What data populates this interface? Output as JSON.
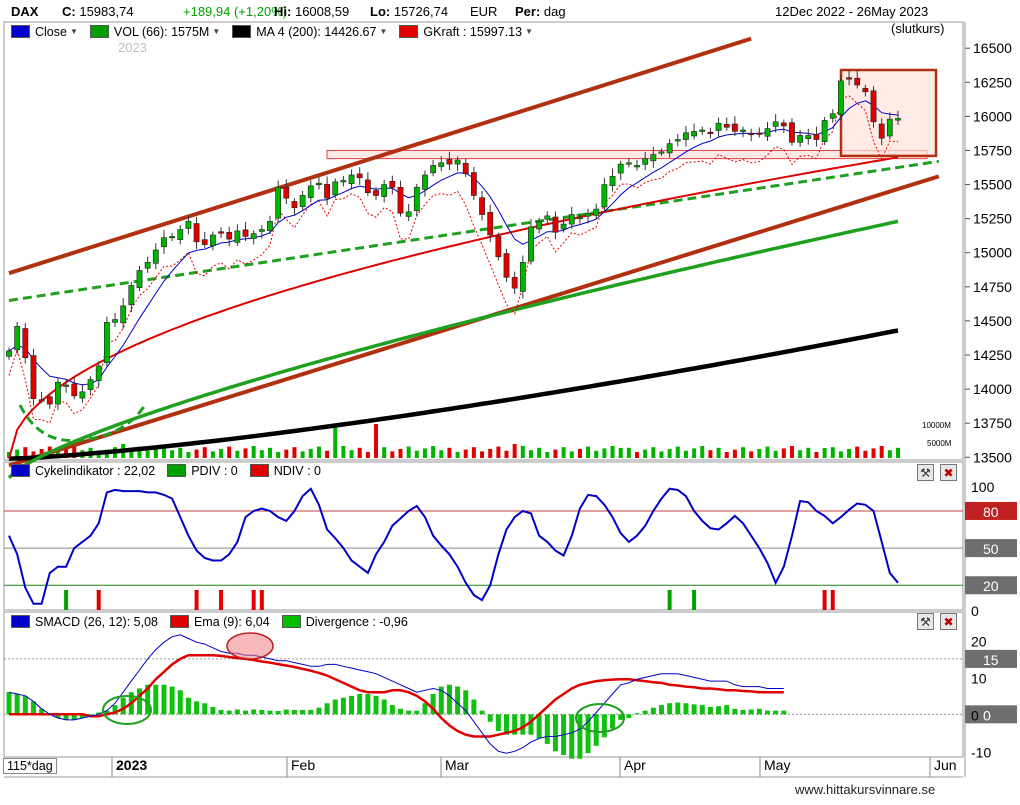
{
  "header": {
    "symbol": "DAX",
    "close_label": "C:",
    "close_value": "15983,74",
    "change": "+189,94 (+1,20%)",
    "hi_label": "Hi:",
    "hi_value": "16008,59",
    "lo_label": "Lo:",
    "lo_value": "15726,74",
    "currency": "EUR",
    "period_label": "Per:",
    "period_value": "dag",
    "date_range": "12Dec 2022 - 26May 2023",
    "price_basis": "(slutkurs)"
  },
  "legend_main": [
    {
      "label": "Close",
      "color": "#0000c8"
    },
    {
      "label": "VOL (66): 1575M",
      "color": "#00a000"
    },
    {
      "label": "MA 4 (200): 14426.67",
      "color": "#000000"
    },
    {
      "label": "GKraft : 15997.13",
      "color": "#e00000"
    }
  ],
  "legend_cycle": [
    {
      "label": "Cykelindikator : 22,02",
      "color": "#0000c8"
    },
    {
      "label": "PDIV : 0",
      "color": "#00a000"
    },
    {
      "label": "NDIV : 0",
      "color": "#e00000"
    }
  ],
  "legend_macd": [
    {
      "label": "SMACD (26, 12): 5,08",
      "color": "#0000c8"
    },
    {
      "label": "Ema (9): 6,04",
      "color": "#e00000"
    },
    {
      "label": "Divergence : -0,96",
      "color": "#00c000"
    }
  ],
  "watermark_year": "2023",
  "period_box": "115*dag",
  "footer_url": "www.hittakursvinnare.se",
  "icons": {
    "settings": "wrench-icon",
    "close": "close-icon"
  },
  "colors": {
    "up": "#00b400",
    "down": "#e00000",
    "close": "#0000c8",
    "trend": "#b03010",
    "ma200": "#000000",
    "ma_mid": "#20a020",
    "gkraft": "#e00000"
  },
  "chart_data": [
    {
      "type": "candlestick",
      "title": "DAX",
      "x_ticks": [
        "2023",
        "Feb",
        "Mar",
        "Apr",
        "May",
        "Jun"
      ],
      "y_ticks": [
        13500,
        13750,
        14000,
        14250,
        14500,
        14750,
        15000,
        15250,
        15500,
        15750,
        16000,
        16250,
        16500
      ],
      "ylim": [
        13480,
        16560
      ],
      "grid": false,
      "close_series": [
        14280,
        14460,
        14230,
        13930,
        13920,
        13890,
        14050,
        14030,
        13950,
        13980,
        14070,
        14170,
        14490,
        14510,
        14610,
        14760,
        14870,
        14930,
        15020,
        15110,
        15120,
        15170,
        15230,
        15080,
        15060,
        15130,
        15150,
        15100,
        15160,
        15120,
        15140,
        15170,
        15230,
        15480,
        15400,
        15330,
        15420,
        15490,
        15510,
        15400,
        15520,
        15530,
        15570,
        15550,
        15440,
        15420,
        15500,
        15480,
        15290,
        15300,
        15480,
        15570,
        15640,
        15660,
        15650,
        15680,
        15580,
        15420,
        15280,
        15130,
        14970,
        14820,
        14740,
        14930,
        15190,
        15230,
        15270,
        15150,
        15210,
        15280,
        15260,
        15290,
        15320,
        15500,
        15560,
        15650,
        15660,
        15640,
        15690,
        15720,
        15740,
        15800,
        15830,
        15880,
        15890,
        15900,
        15880,
        15950,
        15920,
        15890,
        15900,
        15870,
        15870,
        15910,
        15960,
        15930,
        15810,
        15860,
        15860,
        15830,
        15970,
        16020,
        16260,
        16280,
        16230,
        16180,
        15960,
        15840,
        15980,
        15984
      ],
      "ohlc_note": "candles drawn per trading day from close_series",
      "volume_scale_labels": [
        "10000M",
        "5000M"
      ],
      "resistance_band": [
        15690,
        15750
      ],
      "highlight_box": [
        15710,
        16340
      ],
      "trend_channel": {
        "upper_start": [
          0,
          14850
        ],
        "upper_end": [
          91,
          16570
        ],
        "lower_start": [
          0,
          13440
        ],
        "lower_end": [
          114,
          15560
        ]
      },
      "support_dashed": {
        "start": [
          0,
          14650
        ],
        "end": [
          114,
          15670
        ]
      },
      "ma_200_start": 13490,
      "ma_200_end": 14430,
      "ma_mid_start": 13350,
      "ma_mid_end": 15230,
      "gkraft_start": 13490,
      "gkraft_end": 15700
    },
    {
      "type": "line",
      "title": "Cykelindikator",
      "y_ticks": [
        0,
        25,
        50,
        75,
        100
      ],
      "ylim": [
        0,
        100
      ],
      "levels": [
        {
          "value": 80,
          "label": "80"
        },
        {
          "value": 50,
          "label": "50"
        },
        {
          "value": 20,
          "label": "20"
        }
      ],
      "values": [
        60,
        45,
        18,
        5,
        5,
        30,
        35,
        35,
        50,
        55,
        60,
        70,
        95,
        97,
        96,
        96,
        96,
        95,
        95,
        93,
        90,
        75,
        60,
        48,
        42,
        40,
        40,
        45,
        55,
        75,
        80,
        82,
        80,
        75,
        72,
        80,
        92,
        98,
        85,
        65,
        58,
        50,
        40,
        35,
        30,
        45,
        55,
        68,
        74,
        80,
        84,
        75,
        60,
        52,
        45,
        35,
        22,
        12,
        8,
        20,
        45,
        65,
        75,
        80,
        78,
        60,
        55,
        48,
        44,
        60,
        82,
        93,
        92,
        85,
        75,
        62,
        55,
        60,
        68,
        80,
        90,
        98,
        97,
        92,
        80,
        72,
        66,
        65,
        70,
        76,
        70,
        60,
        50,
        38,
        22,
        35,
        60,
        88,
        87,
        80,
        76,
        70,
        75,
        81,
        86,
        85,
        80,
        55,
        30,
        22
      ],
      "pdiv_bars": [
        7,
        81,
        84
      ],
      "ndiv_bars": [
        23,
        26,
        30,
        31,
        100,
        101,
        121
      ]
    },
    {
      "type": "line",
      "title": "SMACD",
      "y_ticks": [
        -10,
        0,
        10,
        20
      ],
      "ylim": [
        -12,
        22
      ],
      "levels": [
        {
          "value": 15,
          "label": "15"
        },
        {
          "value": 0,
          "label": "0"
        }
      ],
      "smacd": [
        6,
        5.5,
        5,
        3.5,
        1.5,
        0,
        -1,
        -1.5,
        -1.5,
        -1,
        -0.5,
        0,
        1,
        3,
        6,
        9,
        12,
        15,
        17.5,
        19.5,
        21,
        21.5,
        20.5,
        19.5,
        19,
        18,
        17,
        16.5,
        16.5,
        16,
        16,
        15.5,
        15,
        14.5,
        14.5,
        14,
        13.5,
        13,
        13,
        13.5,
        13.5,
        13,
        12.5,
        12,
        11.5,
        11,
        10,
        9,
        8,
        7,
        6,
        6.5,
        7,
        6.5,
        5,
        3,
        1,
        -2,
        -5,
        -8,
        -10,
        -10.5,
        -10,
        -9,
        -7.5,
        -6.5,
        -6,
        -6,
        -5.5,
        -5,
        -4,
        -2,
        0.5,
        3,
        5.5,
        8,
        8.5,
        9.5,
        10,
        10.5,
        11,
        11,
        11,
        10.5,
        10,
        9.5,
        9,
        9,
        9,
        8,
        7.5,
        7.5,
        7.5,
        7,
        7,
        7,
        6.5,
        6.5,
        6,
        5.5,
        5.5,
        6,
        6,
        6,
        5.5,
        5
      ],
      "ema": [
        0,
        0,
        0,
        0,
        0,
        0,
        0,
        0,
        0,
        0,
        -0.5,
        -0.5,
        0,
        0.5,
        1.5,
        3,
        5,
        7,
        9.5,
        11.5,
        13.5,
        15,
        16,
        16,
        16,
        16,
        15.8,
        15.5,
        15.2,
        15,
        14.7,
        14.3,
        14,
        13.6,
        13.2,
        12.8,
        12.3,
        11.8,
        11.2,
        10.5,
        9.5,
        8.5,
        7.5,
        6.5,
        6,
        6,
        6,
        6.5,
        6.5,
        6,
        5,
        3.5,
        1.5,
        -1,
        -3,
        -4.5,
        -5.5,
        -6,
        -6,
        -6,
        -5.5,
        -5,
        -4.5,
        -3.5,
        -2,
        0,
        2,
        4,
        5.5,
        7,
        8,
        8.5,
        9,
        9.2,
        9.4,
        9.5,
        9.5,
        9.2,
        9,
        8.7,
        8.5,
        8,
        7.8,
        7.5,
        7.3,
        7,
        7,
        6.8,
        6.5,
        6.5,
        6.3,
        6.2,
        6,
        6,
        6,
        6
      ],
      "divergence_note": "histogram = smacd - ema"
    }
  ]
}
